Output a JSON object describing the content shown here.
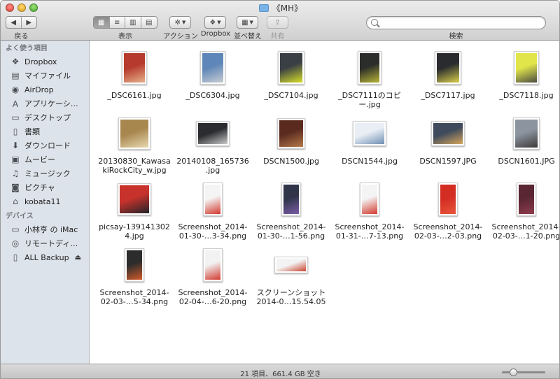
{
  "window": {
    "title": "《MH》"
  },
  "toolbar": {
    "back_label": "戻る",
    "view_label": "表示",
    "action_label": "アクション",
    "dropbox_label": "Dropbox",
    "sort_label": "並べ替え",
    "share_label": "共有",
    "search_label": "検索",
    "search_value": ""
  },
  "sidebar": {
    "favorites_header": "よく使う項目",
    "favorites": [
      {
        "label": "Dropbox",
        "icon": "dropbox-icon"
      },
      {
        "label": "マイファイル",
        "icon": "all-files-icon"
      },
      {
        "label": "AirDrop",
        "icon": "airdrop-icon"
      },
      {
        "label": "アプリケーシ…",
        "icon": "applications-icon"
      },
      {
        "label": "デスクトップ",
        "icon": "desktop-icon"
      },
      {
        "label": "書類",
        "icon": "documents-icon"
      },
      {
        "label": "ダウンロード",
        "icon": "downloads-icon"
      },
      {
        "label": "ムービー",
        "icon": "movies-icon"
      },
      {
        "label": "ミュージック",
        "icon": "music-icon"
      },
      {
        "label": "ピクチャ",
        "icon": "pictures-icon"
      },
      {
        "label": "kobata11",
        "icon": "home-icon"
      }
    ],
    "devices_header": "デバイス",
    "devices": [
      {
        "label": "小林亨 の iMac",
        "icon": "imac-icon"
      },
      {
        "label": "リモートディ…",
        "icon": "remote-disc-icon"
      },
      {
        "label": "ALL Backup",
        "icon": "drive-icon"
      }
    ]
  },
  "files": [
    {
      "name": "_DSC6161.jpg",
      "name2": "",
      "colors": [
        "#b63a2e",
        "#e6b089"
      ]
    },
    {
      "name": "_DSC6304.jpg",
      "name2": "",
      "colors": [
        "#5f86b8",
        "#c8cdd2"
      ]
    },
    {
      "name": "_DSC7104.jpg",
      "name2": "",
      "colors": [
        "#3a3f45",
        "#d6df28"
      ]
    },
    {
      "name": "_DSC7111のコピ",
      "name2": "ー.jpg",
      "colors": [
        "#2b2d2a",
        "#b7b436"
      ]
    },
    {
      "name": "_DSC7117.jpg",
      "name2": "",
      "colors": [
        "#292b2f",
        "#d9cf4b"
      ]
    },
    {
      "name": "_DSC7118.jpg",
      "name2": "",
      "colors": [
        "#e1e54a",
        "#4a4b42"
      ]
    },
    {
      "name": "20130830_Kawasa",
      "name2": "kiRockCity_w.jpg",
      "colors": [
        "#a8874f",
        "#e8d9b0"
      ]
    },
    {
      "name": "20140108_165736",
      "name2": ".jpg",
      "colors": [
        "#2a2c2f",
        "#c9c9c9"
      ]
    },
    {
      "name": "DSCN1500.jpg",
      "name2": "",
      "colors": [
        "#5a2a1f",
        "#b57a4a"
      ]
    },
    {
      "name": "DSCN1544.jpg",
      "name2": "",
      "colors": [
        "#e8eef4",
        "#6f8fb4"
      ]
    },
    {
      "name": "DSCN1597.JPG",
      "name2": "",
      "colors": [
        "#3f4b5c",
        "#d6a65d"
      ]
    },
    {
      "name": "DSCN1601.JPG",
      "name2": "",
      "colors": [
        "#8b949f",
        "#3d3a39"
      ]
    },
    {
      "name": "picsay-139141302",
      "name2": "4.jpg",
      "colors": [
        "#c7322c",
        "#222429"
      ]
    },
    {
      "name": "Screenshot_2014-",
      "name2": "01-30-…3-34.png",
      "colors": [
        "#f4f4f4",
        "#d23a2f"
      ]
    },
    {
      "name": "Screenshot_2014-",
      "name2": "01-30-…1-56.png",
      "colors": [
        "#30354a",
        "#7a5ca8"
      ]
    },
    {
      "name": "Screenshot_2014-",
      "name2": "01-31-…7-13.png",
      "colors": [
        "#f4f4f4",
        "#d23a2f"
      ]
    },
    {
      "name": "Screenshot_2014-",
      "name2": "02-03-…2-03.png",
      "colors": [
        "#d32c22",
        "#e8553a"
      ]
    },
    {
      "name": "Screenshot_2014-",
      "name2": "02-03-…1-20.png",
      "colors": [
        "#5a2633",
        "#8e3b4c"
      ]
    },
    {
      "name": "Screenshot_2014-",
      "name2": "02-03-…5-34.png",
      "colors": [
        "#2c2c2c",
        "#d05a2a"
      ]
    },
    {
      "name": "Screenshot_2014-",
      "name2": "02-04-…6-20.png",
      "colors": [
        "#f2f2f2",
        "#d23a2f"
      ]
    },
    {
      "name": "スクリーンショット",
      "name2": "2014-0…15.54.05",
      "colors": [
        "#f3f3f3",
        "#c9442f"
      ]
    }
  ],
  "status": {
    "text": "21 項目、661.4 GB 空き",
    "zoom_fraction": 0.25
  },
  "colors": {
    "sidebar_bg": "#dde3ea",
    "accent": "#7ab1e6"
  }
}
